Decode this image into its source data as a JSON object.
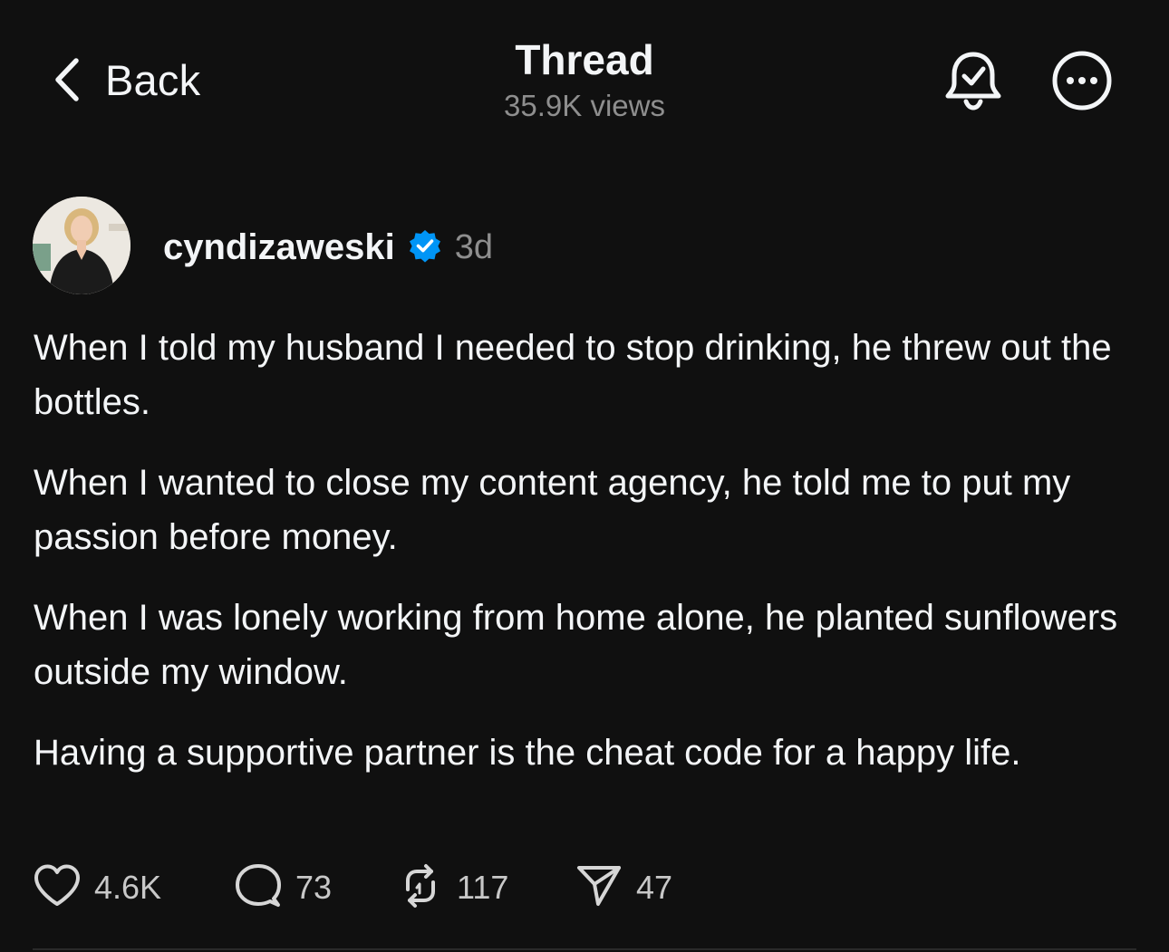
{
  "header": {
    "back_label": "Back",
    "title": "Thread",
    "views": "35.9K views",
    "icons": [
      "bell-check-icon",
      "more-icon"
    ]
  },
  "author": {
    "username": "cyndizaweski",
    "verified": true,
    "timestamp": "3d"
  },
  "post": {
    "paragraphs": [
      "When I told my husband I needed to stop drinking, he threw out the bottles.",
      "When I wanted to close my content agency, he told me to put my passion before money.",
      "When I was lonely working from home alone, he planted sunflowers outside my window.",
      "Having a supportive partner is the cheat code for a happy life."
    ]
  },
  "actions": {
    "likes": "4.6K",
    "replies": "73",
    "reposts": "117",
    "shares": "47"
  },
  "colors": {
    "background": "#101010",
    "text": "#f3f5f7",
    "secondary": "#8e8e8e",
    "verified": "#0095f6"
  }
}
